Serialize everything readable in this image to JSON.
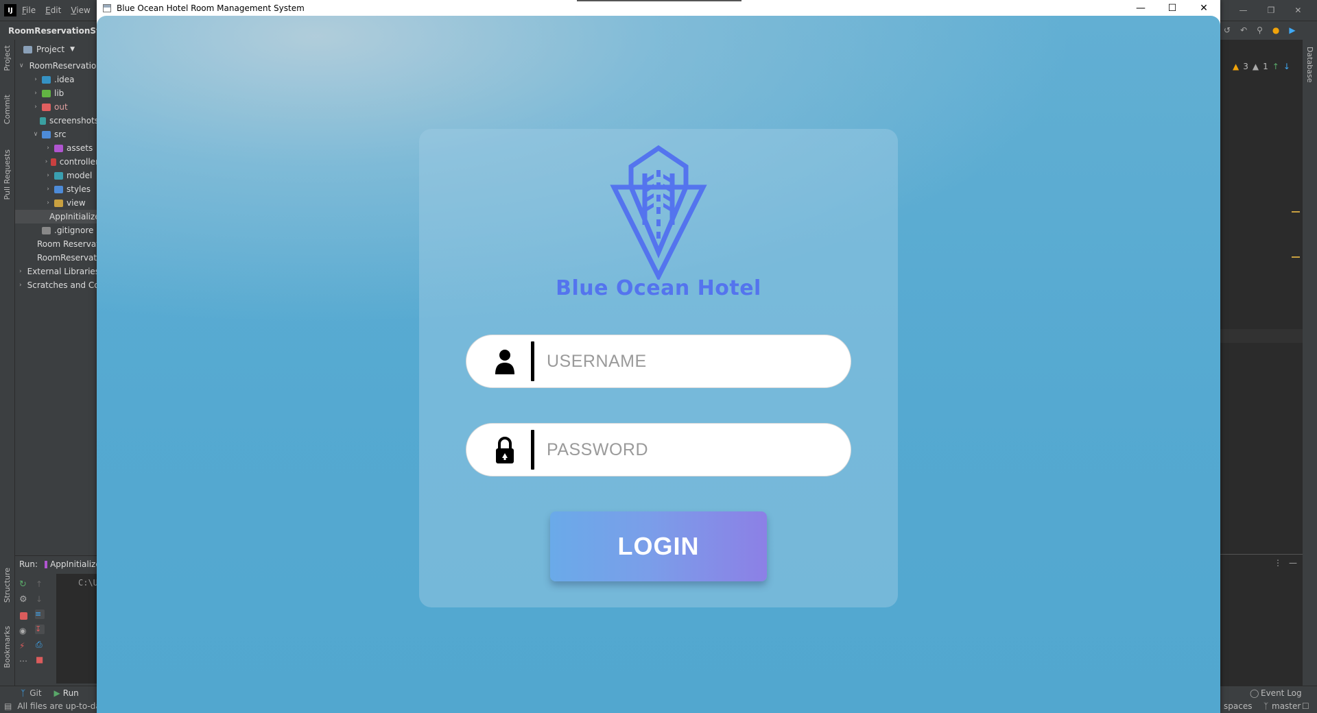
{
  "ide": {
    "menu": [
      "File",
      "Edit",
      "View"
    ],
    "project_name": "RoomReservationSystem",
    "project_tab": "Project",
    "left_tabs": [
      "Project",
      "Commit",
      "Pull Requests",
      "Structure",
      "Bookmarks"
    ],
    "tree": [
      {
        "label": "RoomReservationSystem",
        "indent": 0,
        "arrow": "v",
        "color": "#8aa0b8",
        "sel": false
      },
      {
        "label": ".idea",
        "indent": 1,
        "arrow": ">",
        "color": "#3592c4",
        "sel": false
      },
      {
        "label": "lib",
        "indent": 1,
        "arrow": ">",
        "color": "#62b543",
        "sel": false
      },
      {
        "label": "out",
        "indent": 1,
        "arrow": ">",
        "color": "#e05f5f",
        "sel": false,
        "text_color": "#e0a0a0"
      },
      {
        "label": "screenshots",
        "indent": 1,
        "arrow": "",
        "color": "#3aa0a0",
        "sel": false
      },
      {
        "label": "src",
        "indent": 1,
        "arrow": "v",
        "color": "#4d8bd8",
        "sel": false
      },
      {
        "label": "assets",
        "indent": 2,
        "arrow": ">",
        "color": "#b055d0",
        "sel": false
      },
      {
        "label": "controller",
        "indent": 2,
        "arrow": ">",
        "color": "#c94040",
        "sel": false
      },
      {
        "label": "model",
        "indent": 2,
        "arrow": ">",
        "color": "#3a9fb0",
        "sel": false
      },
      {
        "label": "styles",
        "indent": 2,
        "arrow": ">",
        "color": "#4d8bd8",
        "sel": false
      },
      {
        "label": "view",
        "indent": 2,
        "arrow": ">",
        "color": "#c8a040",
        "sel": false
      },
      {
        "label": "AppInitializer",
        "indent": 2,
        "arrow": "",
        "color": "#4d8bd8",
        "sel": true
      },
      {
        "label": ".gitignore",
        "indent": 1,
        "arrow": "",
        "color": "#888888",
        "sel": false
      },
      {
        "label": "Room Reservation",
        "indent": 1,
        "arrow": "",
        "color": "#e08a3a",
        "sel": false
      },
      {
        "label": "RoomReservation",
        "indent": 1,
        "arrow": "",
        "color": "#4d8bd8",
        "sel": false
      },
      {
        "label": "External Libraries",
        "indent": 0,
        "arrow": ">",
        "color": "#b055d0",
        "sel": false
      },
      {
        "label": "Scratches and Consoles",
        "indent": 0,
        "arrow": ">",
        "color": "#a07050",
        "sel": false
      }
    ],
    "run_label": "Run:",
    "run_tab": "AppInitializer",
    "console_text": "C:\\Users",
    "bottom_git": "Git",
    "bottom_run": "Run",
    "status_left": "All files are up-to-date",
    "status_right_spaces": "spaces",
    "status_branch": "master",
    "event_log": "Event Log",
    "warnings": "3",
    "weak_warnings": "1",
    "right_tab": "Database"
  },
  "app": {
    "window_title": "Blue Ocean Hotel Room Management System",
    "brand_name": "Blue Ocean Hotel",
    "username_placeholder": "USERNAME",
    "password_placeholder": "PASSWORD",
    "login_label": "LOGIN",
    "brand_color": "#5474ee"
  }
}
